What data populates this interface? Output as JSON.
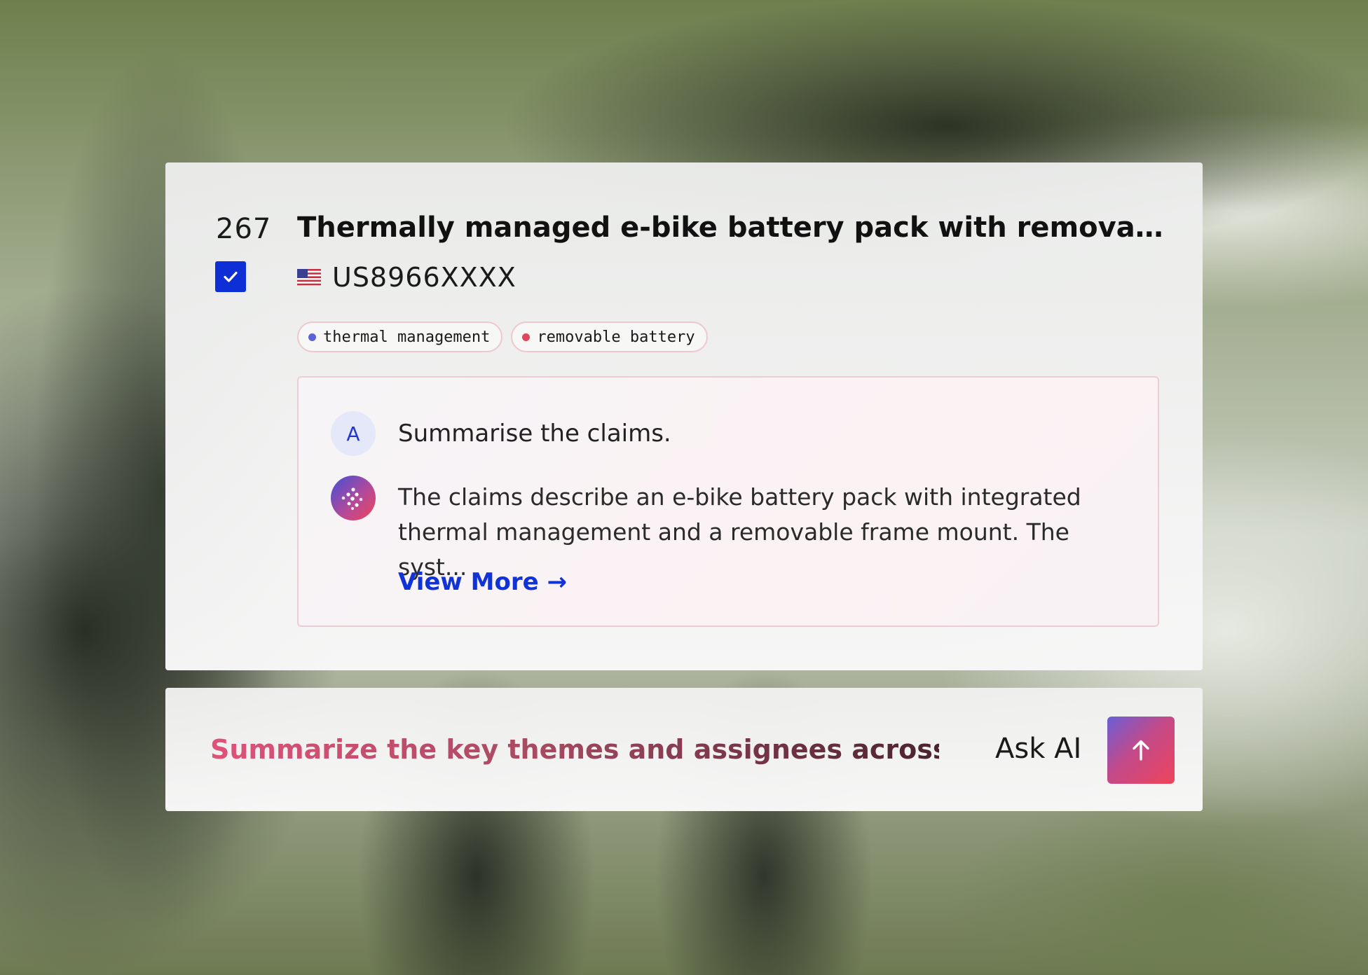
{
  "result": {
    "index": "267",
    "selected": true,
    "title": "Thermally managed e-bike battery pack with removable fram...",
    "country_flag": "us-flag-icon",
    "publication_number": "US8966XXXX",
    "tags": [
      {
        "label": "thermal management",
        "dot_color": "#5a63d8"
      },
      {
        "label": "removable battery",
        "dot_color": "#e0475c"
      }
    ]
  },
  "chat": {
    "user_initial": "A",
    "user_prompt": "Summarise the claims.",
    "ai_answer": "The claims describe an e-bike battery pack with integrated thermal management and a removable frame mount. The syst...",
    "view_more_label": "View More →"
  },
  "ask_bar": {
    "input_text": "Summarize the key themes and assignees across these...",
    "label": "Ask AI",
    "send_icon": "arrow-up-icon"
  },
  "colors": {
    "accent_blue": "#0f2fd6",
    "gradient_start": "#3f4fd6",
    "gradient_end": "#f0445a"
  }
}
